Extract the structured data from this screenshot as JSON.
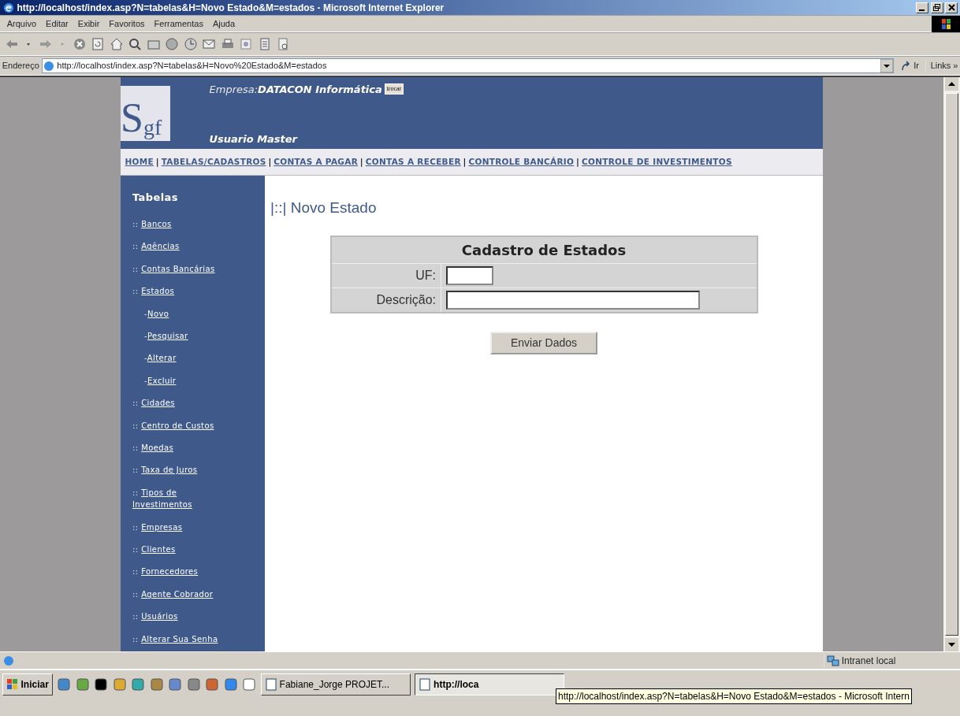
{
  "window": {
    "title": "http://localhost/index.asp?N=tabelas&H=Novo Estado&M=estados - Microsoft Internet Explorer"
  },
  "menu": [
    "Arquivo",
    "Editar",
    "Exibir",
    "Favoritos",
    "Ferramentas",
    "Ajuda"
  ],
  "address_bar": {
    "label": "Endereço",
    "url": "http://localhost/index.asp?N=tabelas&H=Novo%20Estado&M=estados",
    "go": "Ir",
    "links": "Links",
    "links_more": "»"
  },
  "page": {
    "logo": {
      "initial": "S",
      "rest": "gf"
    },
    "company_label": "Empresa:",
    "company": "DATACON Informática",
    "switch_button": "trocar",
    "user": "Usuario Master",
    "nav": {
      "separator": "|",
      "items": [
        "HOME",
        "TABELAS/CADASTROS",
        "CONTAS A PAGAR",
        "CONTAS A RECEBER",
        "CONTROLE BANCÁRIO",
        "CONTROLE DE INVESTIMENTOS"
      ]
    },
    "sidebar": {
      "title": "Tabelas",
      "marker": "::",
      "child_marker": "-",
      "items": [
        {
          "label": "Bancos"
        },
        {
          "label": "Agências"
        },
        {
          "label": "Contas Bancárias"
        },
        {
          "label": "Estados",
          "children": [
            {
              "label": "Novo"
            },
            {
              "label": "Pesquisar"
            },
            {
              "label": "Alterar"
            },
            {
              "label": "Excluir"
            }
          ]
        },
        {
          "label": "Cidades"
        },
        {
          "label": "Centro de Custos"
        },
        {
          "label": "Moedas"
        },
        {
          "label": "Taxa de Juros"
        },
        {
          "label": "Tipos de Investimentos"
        },
        {
          "label": "Empresas"
        },
        {
          "label": "Clientes"
        },
        {
          "label": "Fornecedores"
        },
        {
          "label": "Agente Cobrador"
        },
        {
          "label": "Usuários"
        },
        {
          "label": "Alterar Sua Senha"
        }
      ]
    },
    "heading_marker": "|::|",
    "heading": "Novo Estado",
    "form": {
      "title": "Cadastro de Estados",
      "fields": [
        {
          "label": "UF:",
          "kind": "short"
        },
        {
          "label": "Descrição:",
          "kind": "long"
        }
      ],
      "submit": "Enviar Dados"
    }
  },
  "status_bar": {
    "zone": "Intranet local"
  },
  "taskbar": {
    "start": "Iniciar",
    "tasks": [
      {
        "label": "Fabiane_Jorge PROJET...",
        "selected": false
      },
      {
        "label": "http://loca",
        "selected": true
      }
    ],
    "tooltip": "http://localhost/index.asp?N=tabelas&H=Novo Estado&M=estados - Microsoft Intern"
  }
}
